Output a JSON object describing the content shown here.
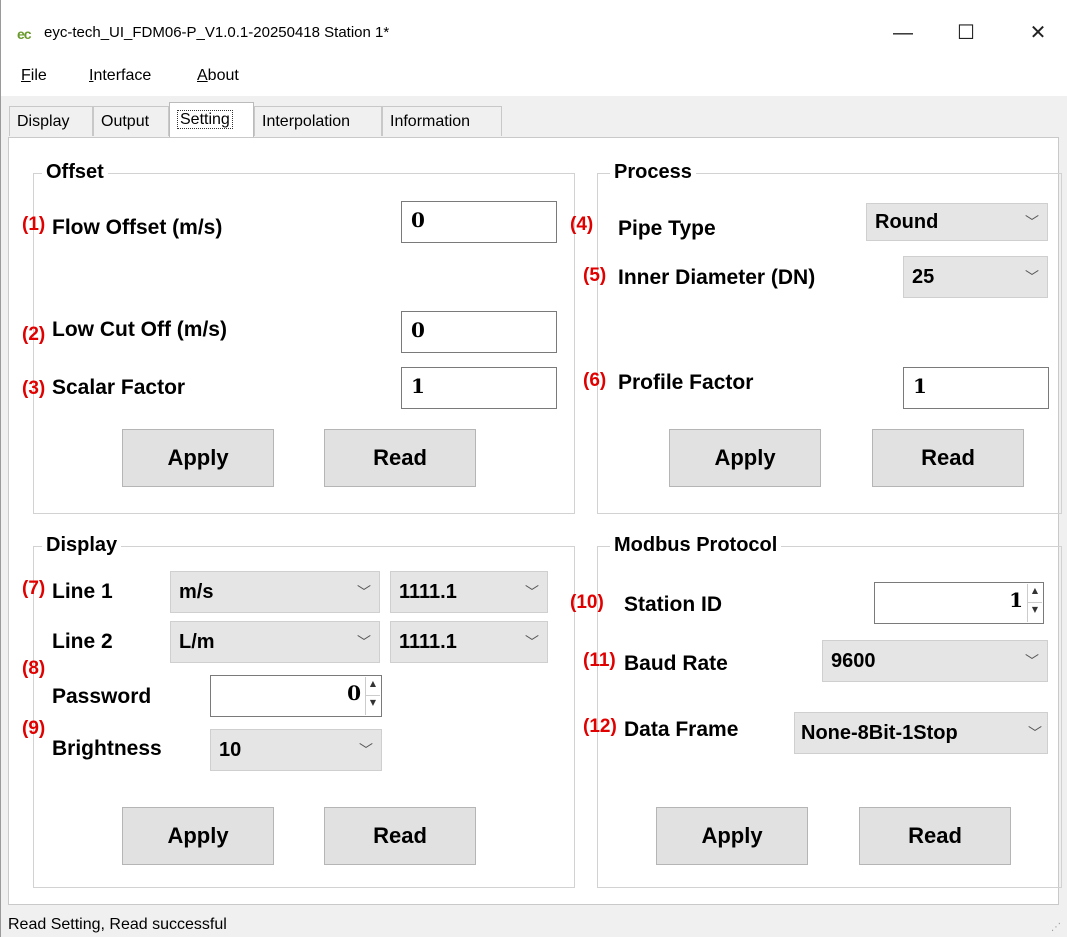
{
  "window": {
    "logo_text": "ec",
    "title": "eyc-tech_UI_FDM06-P_V1.0.1-20250418  Station 1*",
    "minimize_glyph": "—",
    "maximize_glyph": "☐",
    "close_glyph": "✕"
  },
  "menu": {
    "file": {
      "mnemonic": "F",
      "rest": "ile"
    },
    "interface": {
      "mnemonic": "I",
      "rest": "nterface"
    },
    "about": {
      "mnemonic": "A",
      "rest": "bout"
    }
  },
  "tabs": [
    {
      "label": "Display"
    },
    {
      "label": "Output"
    },
    {
      "label": "Setting",
      "active": true
    },
    {
      "label": "Interpolation"
    },
    {
      "label": "Information"
    }
  ],
  "offset": {
    "title": "Offset",
    "flow_offset": {
      "num": "(1)",
      "label": "Flow Offset  (m/s)",
      "value": "0"
    },
    "low_cut_off": {
      "num": "(2)",
      "label": "Low Cut Off  (m/s)",
      "value": "0"
    },
    "scalar_factor": {
      "num": "(3)",
      "label": "Scalar Factor",
      "value": "1"
    },
    "apply_label": "Apply",
    "read_label": "Read"
  },
  "process": {
    "title": "Process",
    "pipe_type": {
      "num": "(4)",
      "label": "Pipe Type",
      "value": "Round"
    },
    "inner_diameter": {
      "num": "(5)",
      "label": "Inner Diameter (DN)",
      "value": "25"
    },
    "profile_factor": {
      "num": "(6)",
      "label": "Profile Factor",
      "value": "1"
    },
    "apply_label": "Apply",
    "read_label": "Read"
  },
  "display": {
    "title": "Display",
    "line1": {
      "num": "(7)",
      "label": "Line 1",
      "unit": "m/s",
      "format": "1111.1"
    },
    "line2": {
      "label": "Line 2",
      "unit": "L/m",
      "format": "1111.1"
    },
    "num8": "(8)",
    "password": {
      "label": "Password",
      "value": "0"
    },
    "num9": "(9)",
    "brightness": {
      "label": "Brightness",
      "value": "10"
    },
    "apply_label": "Apply",
    "read_label": "Read"
  },
  "modbus": {
    "title": "Modbus Protocol",
    "station_id": {
      "num": "(10)",
      "label": "Station ID",
      "value": "1"
    },
    "baud_rate": {
      "num": "(11)",
      "label": "Baud Rate",
      "value": "9600"
    },
    "data_frame": {
      "num": "(12)",
      "label": "Data Frame",
      "value": "None-8Bit-1Stop"
    },
    "apply_label": "Apply",
    "read_label": "Read"
  },
  "status": {
    "text": "Read Setting,   Read successful"
  },
  "colors": {
    "annotation": "#e00000",
    "tab_page": "#ffffff",
    "window_bg": "#f0f0f0",
    "button": "#e1e1e1",
    "combo": "#e5e5e5"
  },
  "icons": {
    "dropdown": "chevron-down-icon",
    "spinner": "spin-arrows-icon",
    "resize_grip": "resize-grip-icon"
  }
}
